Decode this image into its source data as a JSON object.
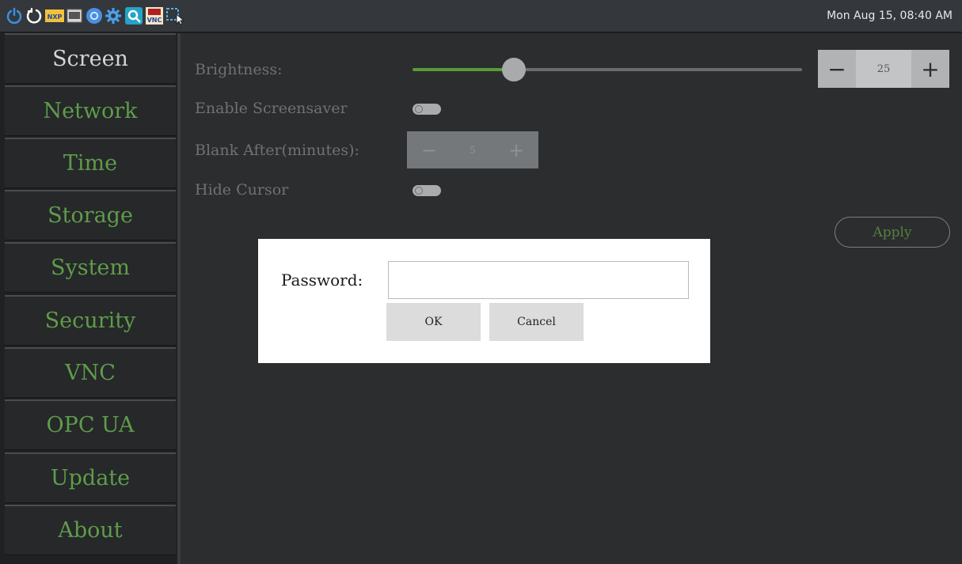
{
  "taskbar": {
    "icons": [
      "power-icon",
      "restart-icon",
      "nxp-app-icon",
      "terminal-icon",
      "chromium-icon",
      "settings-gear-icon",
      "search-app-icon",
      "tightvnc-icon",
      "screenshot-icon"
    ],
    "nxp_text": "NXP",
    "vnc_text": "VNC",
    "clock": "Mon Aug 15, 08:40 AM"
  },
  "sidebar": {
    "items": [
      {
        "label": "Screen",
        "active": true
      },
      {
        "label": "Network",
        "active": false
      },
      {
        "label": "Time",
        "active": false
      },
      {
        "label": "Storage",
        "active": false
      },
      {
        "label": "System",
        "active": false
      },
      {
        "label": "Security",
        "active": false
      },
      {
        "label": "VNC",
        "active": false
      },
      {
        "label": "OPC UA",
        "active": false
      },
      {
        "label": "Update",
        "active": false
      },
      {
        "label": "About",
        "active": false
      }
    ]
  },
  "screen": {
    "brightness_label": "Brightness:",
    "brightness_value": "25",
    "brightness_slider_fraction": 0.25,
    "minus": "−",
    "plus": "+",
    "screensaver_label": "Enable Screensaver",
    "screensaver_enabled": false,
    "blank_after_label": "Blank After(minutes):",
    "blank_after_value": "5",
    "hide_cursor_label": "Hide Cursor",
    "hide_cursor_enabled": false,
    "apply_label": "Apply"
  },
  "dialog": {
    "password_label": "Password:",
    "password_value": "",
    "ok_label": "OK",
    "cancel_label": "Cancel"
  },
  "colors": {
    "accent_green": "#5f9c4a",
    "background": "#2b2d2f",
    "sidebar": "#1f2123"
  }
}
